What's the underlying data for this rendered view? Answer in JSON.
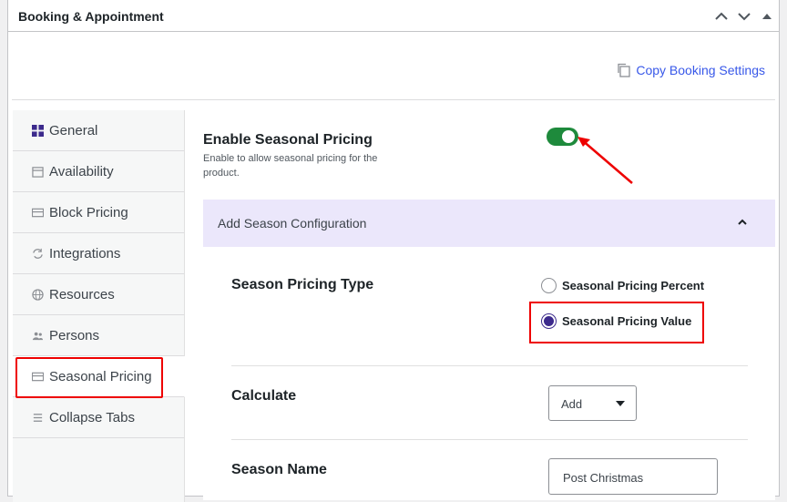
{
  "metabox": {
    "title": "Booking & Appointment"
  },
  "copy_link": {
    "label": "Copy Booking Settings"
  },
  "tabs": [
    {
      "label": "General",
      "icon": "grid-icon"
    },
    {
      "label": "Availability",
      "icon": "calendar-icon"
    },
    {
      "label": "Block Pricing",
      "icon": "card-icon"
    },
    {
      "label": "Integrations",
      "icon": "sync-icon"
    },
    {
      "label": "Resources",
      "icon": "globe-icon"
    },
    {
      "label": "Persons",
      "icon": "persons-icon"
    },
    {
      "label": "Seasonal Pricing",
      "icon": "card-icon"
    },
    {
      "label": "Collapse Tabs",
      "icon": "menu-icon"
    }
  ],
  "enable": {
    "title": "Enable Seasonal Pricing",
    "description": "Enable to allow seasonal pricing for the product."
  },
  "season_box": {
    "header": "Add Season Configuration"
  },
  "pricing_type": {
    "label": "Season Pricing Type",
    "options": [
      "Seasonal Pricing Percent",
      "Seasonal Pricing Value"
    ],
    "selected": "Seasonal Pricing Value"
  },
  "calculate": {
    "label": "Calculate",
    "value": "Add"
  },
  "season_name": {
    "label": "Season Name",
    "value": "Post Christmas"
  },
  "colors": {
    "accent": "#3c2a8c",
    "toggle_on": "#1e8a3c",
    "highlight": "#ee0000",
    "header_bg": "#ebe7fb",
    "link": "#3858e9"
  }
}
